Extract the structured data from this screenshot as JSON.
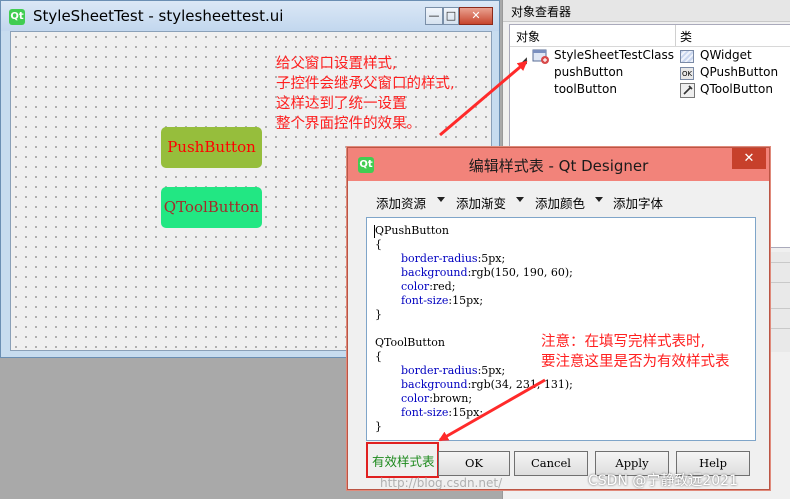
{
  "form_window": {
    "title": "StyleSheetTest - stylesheettest.ui",
    "min_glyph": "—",
    "max_glyph": "□",
    "close_glyph": "✕",
    "qt_icon_glyph": "Qt",
    "push_button_label": "PushButton",
    "tool_button_label": "QToolButton"
  },
  "inspector": {
    "title": "对象查看器",
    "col_object": "对象",
    "col_class": "类",
    "rows": [
      {
        "object": "StyleSheetTestClass",
        "class": "QWidget"
      },
      {
        "object": "pushButton",
        "class": "QPushButton"
      },
      {
        "object": "toolButton",
        "class": "QToolButton"
      }
    ],
    "push_icon_text": "OK"
  },
  "annotations": {
    "note1": [
      "给父窗口设置样式,",
      "子控件会继承父窗口的样式,",
      "这样达到了统一设置",
      "整个界面控件的效果。"
    ],
    "note2": [
      "注意：在填写完样式表时,",
      "要注意这里是否为有效样式表"
    ]
  },
  "dialog": {
    "title": "编辑样式表 - Qt Designer",
    "close_glyph": "✕",
    "qt_icon_glyph": "Qt",
    "toolbar": {
      "add_resource": "添加资源",
      "add_gradient": "添加渐变",
      "add_color": "添加颜色",
      "add_font": "添加字体"
    },
    "code": {
      "sel1": "QPushButton",
      "open1": "{",
      "l1a_k": "border-radius",
      "l1a_v": ":5px;",
      "l1b_k": "background",
      "l1b_v": ":rgb(150, 190, 60);",
      "l1c_k": "color",
      "l1c_v": ":red;",
      "l1d_k": "font-size",
      "l1d_v": ":15px;",
      "close1": "}",
      "sel2": "QToolButton",
      "open2": "{",
      "l2a_k": "border-radius",
      "l2a_v": ":5px;",
      "l2b_k": "background",
      "l2b_v": ":rgb(34, 231, 131);",
      "l2c_k": "color",
      "l2c_v": ":brown;",
      "l2d_k": "font-size",
      "l2d_v": ":15px;",
      "close2": "}"
    },
    "valid_label": "有效样式表",
    "buttons": {
      "ok": "OK",
      "cancel": "Cancel",
      "apply": "Apply",
      "help": "Help"
    }
  },
  "watermark": "CSDN @宁静致远2021",
  "faint_url": "http://blog.csdn.net/"
}
